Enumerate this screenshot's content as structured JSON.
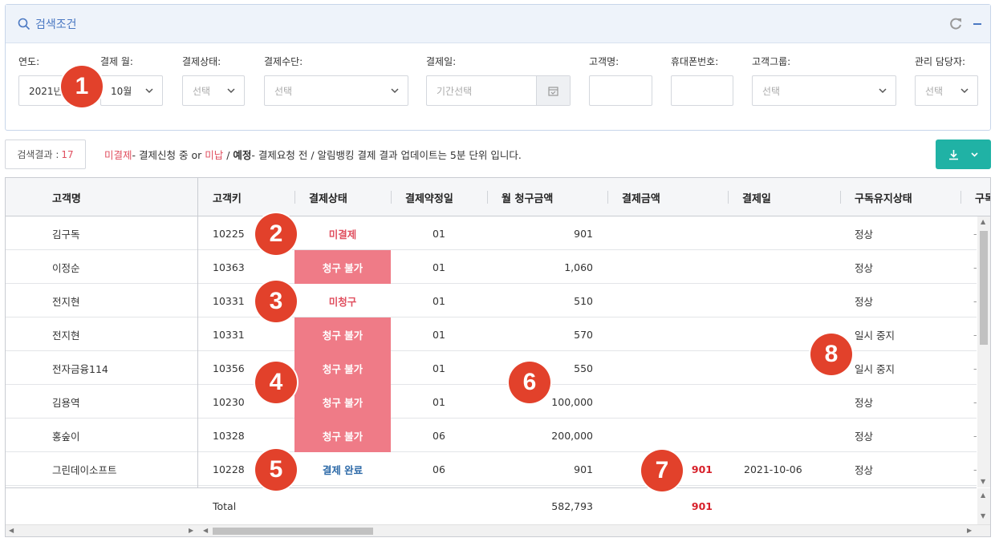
{
  "search": {
    "title": "검색조건",
    "fields": [
      {
        "label": "연도:",
        "value": "2021년"
      },
      {
        "label": "결제 월:",
        "value": "10월"
      },
      {
        "label": "결제상태:",
        "placeholder": "선택"
      },
      {
        "label": "결제수단:",
        "placeholder": "선택"
      },
      {
        "label": "결제일:",
        "placeholder": "기간선택"
      },
      {
        "label": "고객명:",
        "value": ""
      },
      {
        "label": "휴대폰번호:",
        "value": ""
      },
      {
        "label": "고객그룹:",
        "placeholder": "선택"
      },
      {
        "label": "관리 담당자:",
        "placeholder": "선택"
      }
    ]
  },
  "result": {
    "label": "검색결과 :",
    "count": "17"
  },
  "legend": {
    "part1": "미결제",
    "part2": "- 결제신청 중 or ",
    "part3": "미납",
    "part4": " / ",
    "part5": "예정",
    "part6": "- 결제요청 전 / 알림뱅킹 결제 결과 업데이트는 5분 단위 입니다."
  },
  "grid": {
    "headers": [
      "고객명",
      "고객키",
      "결제상태",
      "결제약정일",
      "월 청구금액",
      "결제금액",
      "결제일",
      "구독유지상태",
      "구독"
    ],
    "rows": [
      {
        "name": "김구독",
        "key": "10225",
        "status": "미결제",
        "status_type": "unpaid",
        "day": "01",
        "monthly": "901",
        "paid": "",
        "date": "",
        "sub": "정상"
      },
      {
        "name": "이정순",
        "key": "10363",
        "status": "청구 불가",
        "status_type": "blocked",
        "day": "01",
        "monthly": "1,060",
        "paid": "",
        "date": "",
        "sub": "정상"
      },
      {
        "name": "전지현",
        "key": "10331",
        "status": "미청구",
        "status_type": "unpaid",
        "day": "01",
        "monthly": "510",
        "paid": "",
        "date": "",
        "sub": "정상"
      },
      {
        "name": "전지현",
        "key": "10331",
        "status": "청구 불가",
        "status_type": "blocked",
        "day": "01",
        "monthly": "570",
        "paid": "",
        "date": "",
        "sub": "일시 중지"
      },
      {
        "name": "전자금융114",
        "key": "10356",
        "status": "청구 불가",
        "status_type": "blocked",
        "day": "01",
        "monthly": "550",
        "paid": "",
        "date": "",
        "sub": "일시 중지"
      },
      {
        "name": "김용역",
        "key": "10230",
        "status": "청구 불가",
        "status_type": "blocked",
        "day": "01",
        "monthly": "100,000",
        "paid": "",
        "date": "",
        "sub": "정상"
      },
      {
        "name": "홍숲이",
        "key": "10328",
        "status": "청구 불가",
        "status_type": "blocked",
        "day": "06",
        "monthly": "200,000",
        "paid": "",
        "date": "",
        "sub": "정상"
      },
      {
        "name": "그린데이소프트",
        "key": "10228",
        "status": "결제 완료",
        "status_type": "done",
        "day": "06",
        "monthly": "901",
        "paid": "901",
        "date": "2021-10-06",
        "sub": "정상"
      }
    ],
    "total": {
      "label": "Total",
      "monthly": "582,793",
      "paid": "901"
    }
  },
  "badges": [
    "1",
    "2",
    "3",
    "4",
    "5",
    "6",
    "7",
    "8"
  ],
  "colors": {
    "accent": "#4a78c2",
    "teal": "#20b2a5",
    "blocked": "#ef7b87",
    "badge": "#e2412b",
    "unpaid": "#e04f5f"
  }
}
